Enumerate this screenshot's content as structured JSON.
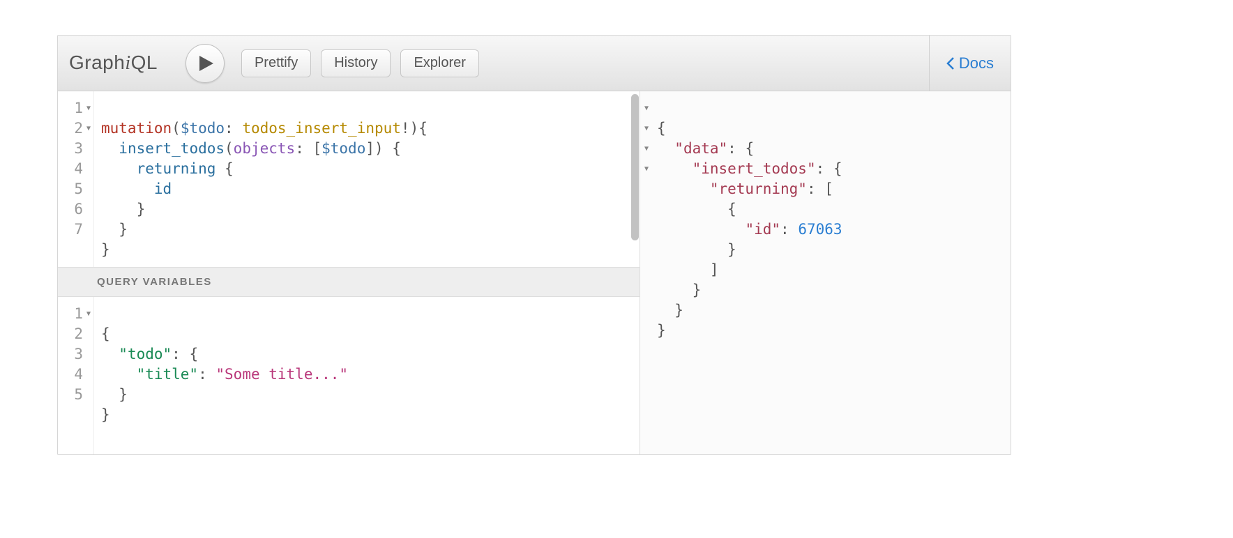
{
  "toolbar": {
    "logo_plain1": "Graph",
    "logo_italic": "i",
    "logo_plain2": "QL",
    "prettify_label": "Prettify",
    "history_label": "History",
    "explorer_label": "Explorer",
    "docs_label": "Docs"
  },
  "query_editor": {
    "lines": [
      "1",
      "2",
      "3",
      "4",
      "5",
      "6",
      "7"
    ],
    "foldable": [
      true,
      true,
      false,
      false,
      false,
      false,
      false
    ],
    "tokens": {
      "l1_kw": "mutation",
      "l1_var": "$todo",
      "l1_type": "todos_insert_input",
      "l1_p1": "(",
      "l1_p2": ": ",
      "l1_p3": "!",
      "l1_p4": ")",
      "l1_p5": "{",
      "l2_indent": "  ",
      "l2_field": "insert_todos",
      "l2_p1": "(",
      "l2_arg": "objects",
      "l2_p2": ": [",
      "l2_var": "$todo",
      "l2_p3": "]) {",
      "l3_indent": "    ",
      "l3_field": "returning",
      "l3_p": " {",
      "l4_indent": "      ",
      "l4_field": "id",
      "l5_indent": "    ",
      "l5_p": "}",
      "l6_indent": "  ",
      "l6_p": "}",
      "l7_p": "}"
    }
  },
  "vars_header": "QUERY VARIABLES",
  "vars_editor": {
    "lines": [
      "1",
      "2",
      "3",
      "4",
      "5"
    ],
    "foldable": [
      true,
      false,
      false,
      false,
      false
    ],
    "tokens": {
      "l1": "{",
      "l2_indent": "  ",
      "l2_key": "\"todo\"",
      "l2_p": ": {",
      "l3_indent": "    ",
      "l3_key": "\"title\"",
      "l3_p1": ": ",
      "l3_val": "\"Some title...\"",
      "l4_indent": "  ",
      "l4": "}",
      "l5": "}"
    }
  },
  "result": {
    "foldable": [
      true,
      true,
      true,
      true,
      false,
      false,
      false,
      false,
      false,
      false,
      false
    ],
    "tokens": {
      "l1": "{",
      "l2_indent": "  ",
      "l2_key": "\"data\"",
      "l2_p": ": {",
      "l3_indent": "    ",
      "l3_key": "\"insert_todos\"",
      "l3_p": ": {",
      "l4_indent": "      ",
      "l4_key": "\"returning\"",
      "l4_p": ": [",
      "l5_indent": "        ",
      "l5": "{",
      "l6_indent": "          ",
      "l6_key": "\"id\"",
      "l6_p": ": ",
      "l6_val": "67063",
      "l7_indent": "        ",
      "l7": "}",
      "l8_indent": "      ",
      "l8": "]",
      "l9_indent": "    ",
      "l9": "}",
      "l10_indent": "  ",
      "l10": "}",
      "l11": "}"
    }
  }
}
